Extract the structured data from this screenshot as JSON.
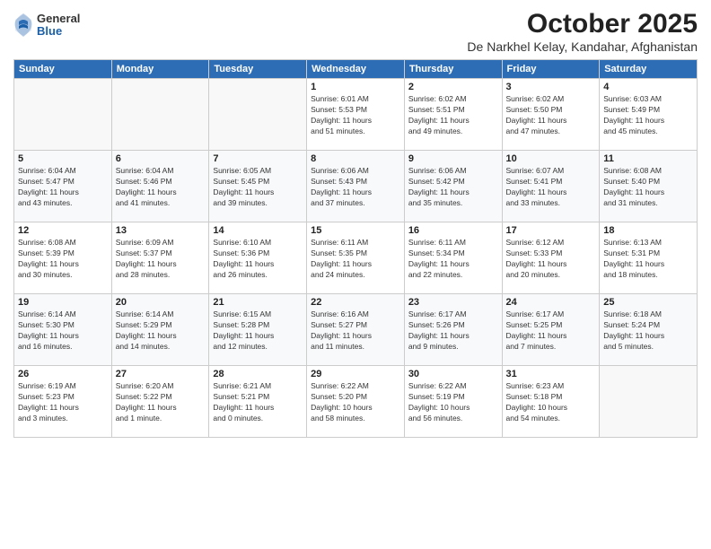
{
  "header": {
    "logo": {
      "general": "General",
      "blue": "Blue"
    },
    "title": "October 2025",
    "location": "De Narkhel Kelay, Kandahar, Afghanistan"
  },
  "weekdays": [
    "Sunday",
    "Monday",
    "Tuesday",
    "Wednesday",
    "Thursday",
    "Friday",
    "Saturday"
  ],
  "weeks": [
    [
      {
        "day": "",
        "info": ""
      },
      {
        "day": "",
        "info": ""
      },
      {
        "day": "",
        "info": ""
      },
      {
        "day": "1",
        "info": "Sunrise: 6:01 AM\nSunset: 5:53 PM\nDaylight: 11 hours\nand 51 minutes."
      },
      {
        "day": "2",
        "info": "Sunrise: 6:02 AM\nSunset: 5:51 PM\nDaylight: 11 hours\nand 49 minutes."
      },
      {
        "day": "3",
        "info": "Sunrise: 6:02 AM\nSunset: 5:50 PM\nDaylight: 11 hours\nand 47 minutes."
      },
      {
        "day": "4",
        "info": "Sunrise: 6:03 AM\nSunset: 5:49 PM\nDaylight: 11 hours\nand 45 minutes."
      }
    ],
    [
      {
        "day": "5",
        "info": "Sunrise: 6:04 AM\nSunset: 5:47 PM\nDaylight: 11 hours\nand 43 minutes."
      },
      {
        "day": "6",
        "info": "Sunrise: 6:04 AM\nSunset: 5:46 PM\nDaylight: 11 hours\nand 41 minutes."
      },
      {
        "day": "7",
        "info": "Sunrise: 6:05 AM\nSunset: 5:45 PM\nDaylight: 11 hours\nand 39 minutes."
      },
      {
        "day": "8",
        "info": "Sunrise: 6:06 AM\nSunset: 5:43 PM\nDaylight: 11 hours\nand 37 minutes."
      },
      {
        "day": "9",
        "info": "Sunrise: 6:06 AM\nSunset: 5:42 PM\nDaylight: 11 hours\nand 35 minutes."
      },
      {
        "day": "10",
        "info": "Sunrise: 6:07 AM\nSunset: 5:41 PM\nDaylight: 11 hours\nand 33 minutes."
      },
      {
        "day": "11",
        "info": "Sunrise: 6:08 AM\nSunset: 5:40 PM\nDaylight: 11 hours\nand 31 minutes."
      }
    ],
    [
      {
        "day": "12",
        "info": "Sunrise: 6:08 AM\nSunset: 5:39 PM\nDaylight: 11 hours\nand 30 minutes."
      },
      {
        "day": "13",
        "info": "Sunrise: 6:09 AM\nSunset: 5:37 PM\nDaylight: 11 hours\nand 28 minutes."
      },
      {
        "day": "14",
        "info": "Sunrise: 6:10 AM\nSunset: 5:36 PM\nDaylight: 11 hours\nand 26 minutes."
      },
      {
        "day": "15",
        "info": "Sunrise: 6:11 AM\nSunset: 5:35 PM\nDaylight: 11 hours\nand 24 minutes."
      },
      {
        "day": "16",
        "info": "Sunrise: 6:11 AM\nSunset: 5:34 PM\nDaylight: 11 hours\nand 22 minutes."
      },
      {
        "day": "17",
        "info": "Sunrise: 6:12 AM\nSunset: 5:33 PM\nDaylight: 11 hours\nand 20 minutes."
      },
      {
        "day": "18",
        "info": "Sunrise: 6:13 AM\nSunset: 5:31 PM\nDaylight: 11 hours\nand 18 minutes."
      }
    ],
    [
      {
        "day": "19",
        "info": "Sunrise: 6:14 AM\nSunset: 5:30 PM\nDaylight: 11 hours\nand 16 minutes."
      },
      {
        "day": "20",
        "info": "Sunrise: 6:14 AM\nSunset: 5:29 PM\nDaylight: 11 hours\nand 14 minutes."
      },
      {
        "day": "21",
        "info": "Sunrise: 6:15 AM\nSunset: 5:28 PM\nDaylight: 11 hours\nand 12 minutes."
      },
      {
        "day": "22",
        "info": "Sunrise: 6:16 AM\nSunset: 5:27 PM\nDaylight: 11 hours\nand 11 minutes."
      },
      {
        "day": "23",
        "info": "Sunrise: 6:17 AM\nSunset: 5:26 PM\nDaylight: 11 hours\nand 9 minutes."
      },
      {
        "day": "24",
        "info": "Sunrise: 6:17 AM\nSunset: 5:25 PM\nDaylight: 11 hours\nand 7 minutes."
      },
      {
        "day": "25",
        "info": "Sunrise: 6:18 AM\nSunset: 5:24 PM\nDaylight: 11 hours\nand 5 minutes."
      }
    ],
    [
      {
        "day": "26",
        "info": "Sunrise: 6:19 AM\nSunset: 5:23 PM\nDaylight: 11 hours\nand 3 minutes."
      },
      {
        "day": "27",
        "info": "Sunrise: 6:20 AM\nSunset: 5:22 PM\nDaylight: 11 hours\nand 1 minute."
      },
      {
        "day": "28",
        "info": "Sunrise: 6:21 AM\nSunset: 5:21 PM\nDaylight: 11 hours\nand 0 minutes."
      },
      {
        "day": "29",
        "info": "Sunrise: 6:22 AM\nSunset: 5:20 PM\nDaylight: 10 hours\nand 58 minutes."
      },
      {
        "day": "30",
        "info": "Sunrise: 6:22 AM\nSunset: 5:19 PM\nDaylight: 10 hours\nand 56 minutes."
      },
      {
        "day": "31",
        "info": "Sunrise: 6:23 AM\nSunset: 5:18 PM\nDaylight: 10 hours\nand 54 minutes."
      },
      {
        "day": "",
        "info": ""
      }
    ]
  ]
}
